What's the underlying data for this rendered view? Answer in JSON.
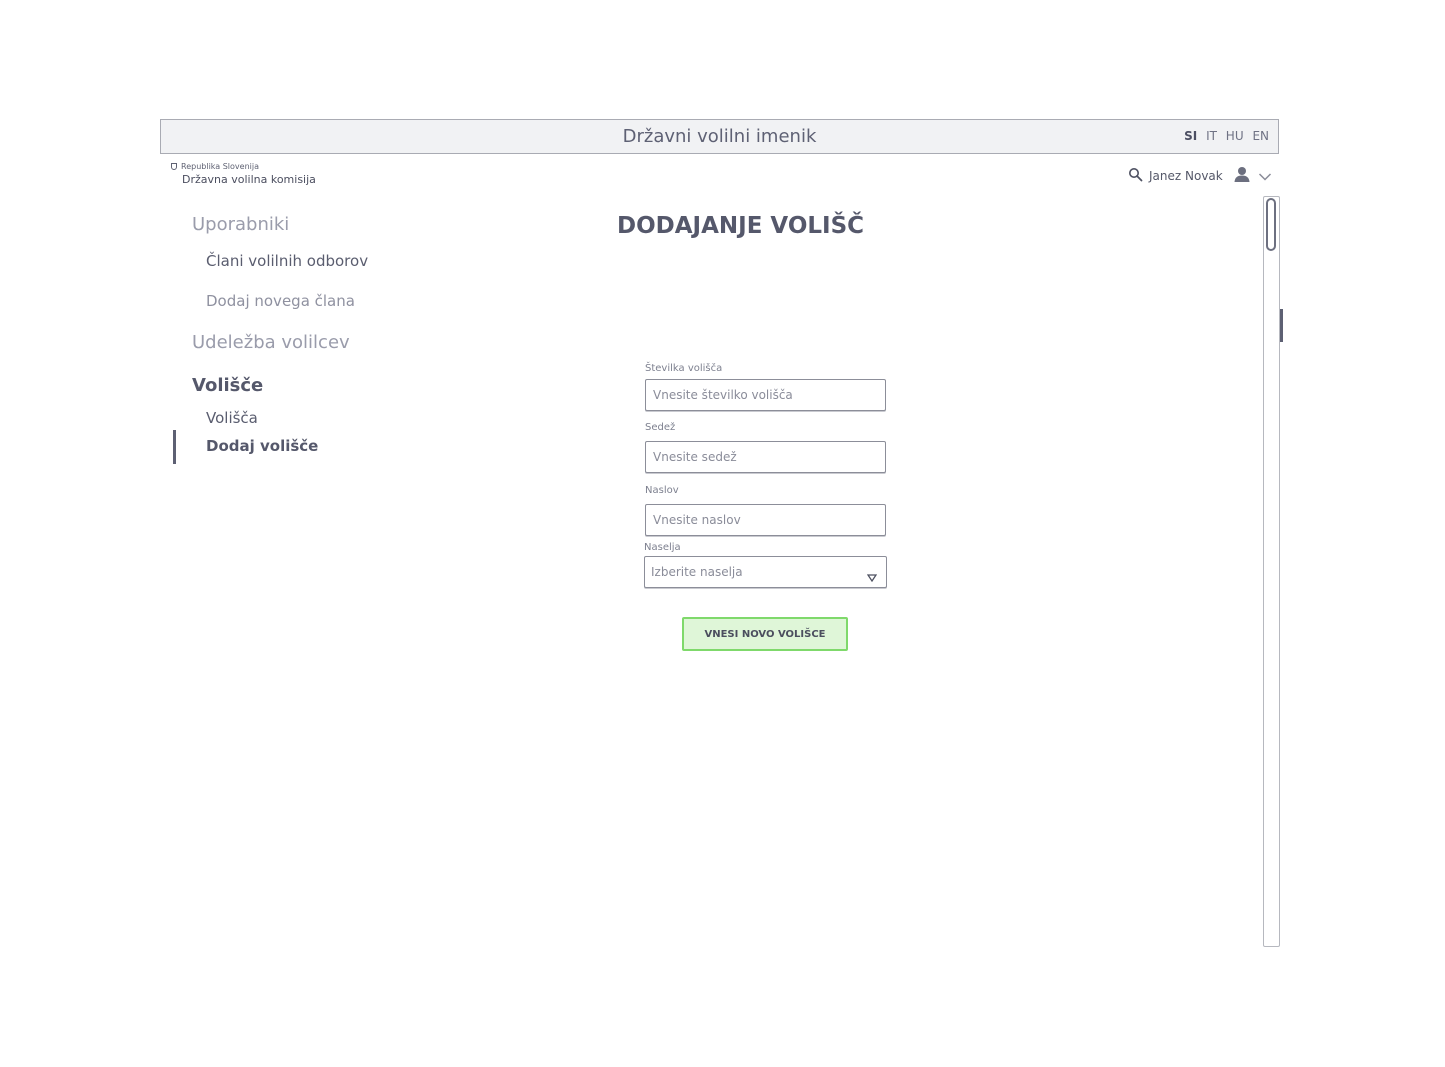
{
  "header": {
    "title": "Državni volilni imenik",
    "languages": [
      "SI",
      "IT",
      "HU",
      "EN"
    ],
    "active_language": "SI"
  },
  "logo": {
    "line1": "Republika Slovenija",
    "line2": "Državna volilna komisija"
  },
  "user": {
    "name": "Janez Novak",
    "icons": [
      "search-icon",
      "user-icon",
      "chevron-down-icon"
    ]
  },
  "sidebar": {
    "sections": [
      {
        "label": "Uporabniki",
        "items": [
          "Člani volilnih odborov",
          "Dodaj novega člana"
        ]
      },
      {
        "label": "Udeležba volilcev",
        "items": []
      },
      {
        "label": "Volišče",
        "items": [
          "Volišča",
          "Dodaj volišče"
        ]
      }
    ],
    "active_section": "Volišče",
    "active_item": "Dodaj volišče"
  },
  "form": {
    "title": "DODAJANJE VOLIŠČ",
    "fields": [
      {
        "label": "Številka volišča",
        "placeholder": "Vnesite številko volišča",
        "value": ""
      },
      {
        "label": "Sedež",
        "placeholder": "Vnesite sedež",
        "value": ""
      },
      {
        "label": "Naslov",
        "placeholder": "Vnesite naslov",
        "value": ""
      }
    ],
    "select": {
      "label": "Naselja",
      "placeholder": "Izberite naselja"
    },
    "submit_label": "VNESI NOVO VOLIŠCE"
  },
  "colors": {
    "submit_bg": "#dff6d8",
    "submit_border": "#7fd96b",
    "text_dark": "#55586b",
    "titlebar_bg": "#f1f2f4"
  }
}
